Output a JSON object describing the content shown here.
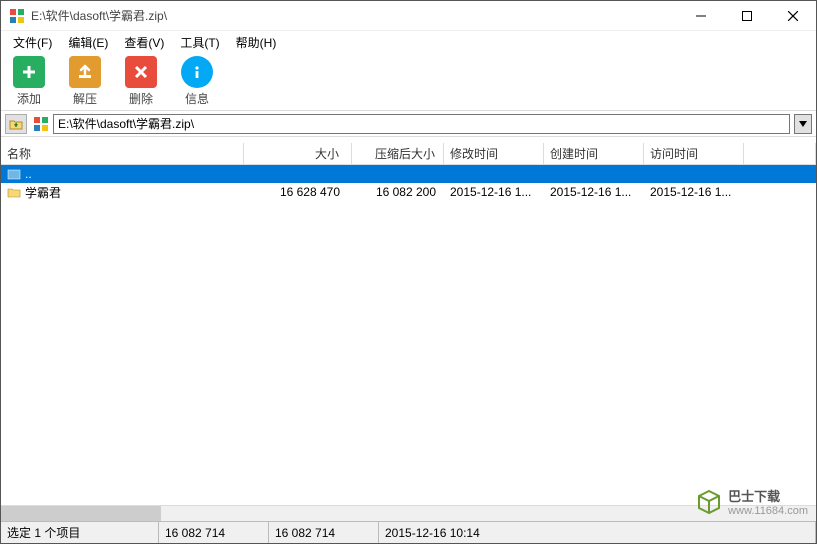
{
  "window": {
    "title": "E:\\软件\\dasoft\\学霸君.zip\\"
  },
  "menu": {
    "file": "文件(F)",
    "edit": "编辑(E)",
    "view": "查看(V)",
    "tools": "工具(T)",
    "help": "帮助(H)"
  },
  "toolbar": {
    "add": "添加",
    "extract": "解压",
    "delete": "删除",
    "info": "信息"
  },
  "address": {
    "path": "E:\\软件\\dasoft\\学霸君.zip\\"
  },
  "columns": {
    "name": "名称",
    "size": "大小",
    "packed": "压缩后大小",
    "mtime": "修改时间",
    "ctime": "创建时间",
    "atime": "访问时间"
  },
  "rows": [
    {
      "name": "..",
      "size": "",
      "packed": "",
      "mtime": "",
      "ctime": "",
      "atime": "",
      "selected": true,
      "icon": "up"
    },
    {
      "name": "学霸君",
      "size": "16 628 470",
      "packed": "16 082 200",
      "mtime": "2015-12-16 1...",
      "ctime": "2015-12-16 1...",
      "atime": "2015-12-16 1...",
      "selected": false,
      "icon": "folder"
    }
  ],
  "status": {
    "selection": "选定 1 个项目",
    "size1": "16 082 714",
    "size2": "16 082 714",
    "time": "2015-12-16 10:14"
  },
  "watermark": {
    "brand": "巴士下载",
    "url": "www.11684.com"
  }
}
